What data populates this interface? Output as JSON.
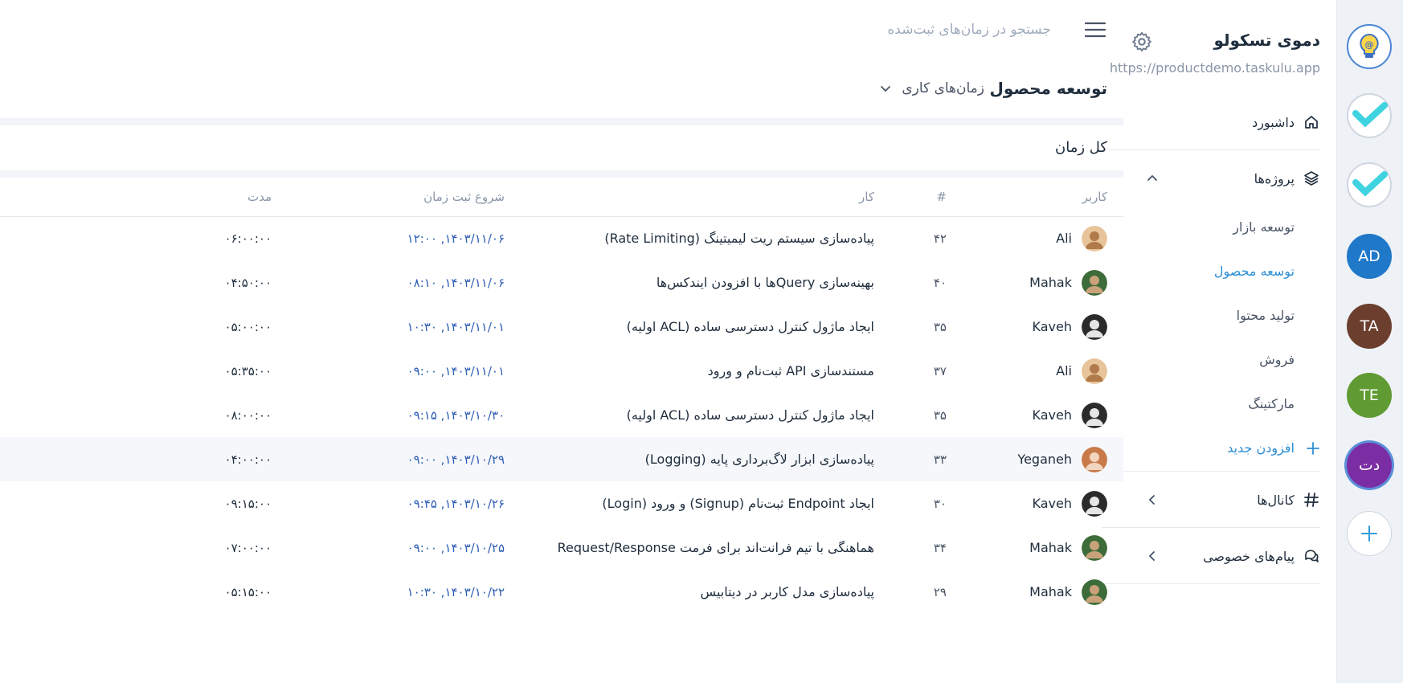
{
  "workspace": {
    "name": "دموی تسکولو",
    "url": "https://productdemo.taskulu.app"
  },
  "rail": {
    "items": [
      {
        "label": "",
        "color": "#ffffff",
        "icon": "bulb-at-icon"
      },
      {
        "label": "",
        "color": "#ffffff",
        "icon": "check-icon"
      },
      {
        "label": "",
        "color": "#ffffff",
        "icon": "check-icon"
      },
      {
        "label": "AD",
        "color": "#1f78c8"
      },
      {
        "label": "TA",
        "color": "#6b3e2e"
      },
      {
        "label": "TE",
        "color": "#5f9a32"
      },
      {
        "label": "دت",
        "color": "#7b2ea3"
      }
    ],
    "add_label": "+"
  },
  "sidebar": {
    "dashboard": "داشبورد",
    "projects": "پروژه‌ها",
    "project_items": [
      "توسعه بازار",
      "توسعه محصول",
      "تولید محتوا",
      "فروش",
      "مارکتینگ"
    ],
    "active_project": "توسعه محصول",
    "add_new": "افزودن جدید",
    "channels": "کانال‌ها",
    "private_messages": "پیام‌های خصوصی"
  },
  "header": {
    "search_placeholder": "جستجو در زمان‌های ثبت‌شده",
    "title": "توسعه محصول",
    "view_label": "زمان‌های کاری"
  },
  "summary": {
    "total_label": "کل زمان"
  },
  "table": {
    "headers": {
      "user": "کاربر",
      "num": "#",
      "task": "کار",
      "start": "شروع ثبت زمان",
      "duration": "مدت"
    },
    "rows": [
      {
        "user": "Ali",
        "num": "۴۲",
        "task": "پیاده‌سازی سیستم ریت لیمیتینگ (Rate Limiting)",
        "start": "۱۴۰۳/۱۱/۰۶, ۱۲:۰۰",
        "duration": "۰۶:۰۰:۰۰"
      },
      {
        "user": "Mahak",
        "num": "۴۰",
        "task": "بهینه‌سازی Queryها با افزودن ایندکس‌ها",
        "start": "۱۴۰۳/۱۱/۰۶, ۰۸:۱۰",
        "duration": "۰۴:۵۰:۰۰"
      },
      {
        "user": "Kaveh",
        "num": "۳۵",
        "task": "ایجاد ماژول کنترل دسترسی ساده (ACL اولیه)",
        "start": "۱۴۰۳/۱۱/۰۱, ۱۰:۳۰",
        "duration": "۰۵:۰۰:۰۰"
      },
      {
        "user": "Ali",
        "num": "۳۷",
        "task": "مستندسازی API ثبت‌نام و ورود",
        "start": "۱۴۰۳/۱۱/۰۱, ۰۹:۰۰",
        "duration": "۰۵:۳۵:۰۰"
      },
      {
        "user": "Kaveh",
        "num": "۳۵",
        "task": "ایجاد ماژول کنترل دسترسی ساده (ACL اولیه)",
        "start": "۱۴۰۳/۱۰/۳۰, ۰۹:۱۵",
        "duration": "۰۸:۰۰:۰۰"
      },
      {
        "user": "Yeganeh",
        "num": "۳۳",
        "task": "پیاده‌سازی ابزار لاگ‌برداری پایه (Logging)",
        "start": "۱۴۰۳/۱۰/۲۹, ۰۹:۰۰",
        "duration": "۰۴:۰۰:۰۰"
      },
      {
        "user": "Kaveh",
        "num": "۳۰",
        "task": "ایجاد Endpoint ثبت‌نام (Signup) و ورود (Login)",
        "start": "۱۴۰۳/۱۰/۲۶, ۰۹:۴۵",
        "duration": "۰۹:۱۵:۰۰"
      },
      {
        "user": "Mahak",
        "num": "۳۴",
        "task": "هماهنگی با تیم فرانت‌اند برای فرمت Request/Response",
        "start": "۱۴۰۳/۱۰/۲۵, ۰۹:۰۰",
        "duration": "۰۷:۰۰:۰۰"
      },
      {
        "user": "Mahak",
        "num": "۲۹",
        "task": "پیاده‌سازی مدل کاربر در دیتابیس",
        "start": "۱۴۰۳/۱۰/۲۲, ۱۰:۳۰",
        "duration": "۰۵:۱۵:۰۰"
      }
    ]
  },
  "colors": {
    "accent": "#2d8fd5",
    "date": "#2d5cb4"
  }
}
